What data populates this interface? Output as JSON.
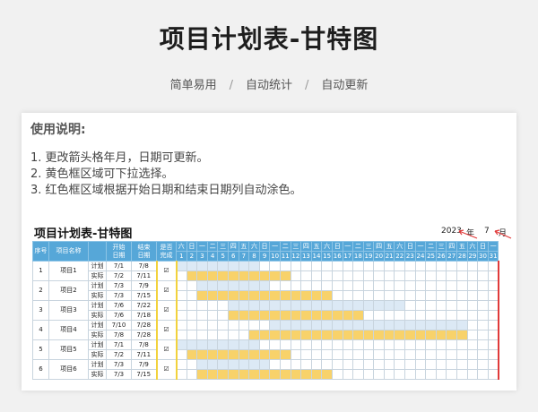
{
  "header": {
    "title": "项目计划表-甘特图",
    "subtitle_items": [
      "简单易用",
      "自动统计",
      "自动更新"
    ],
    "separator": "/"
  },
  "usage": {
    "title": "使用说明:",
    "items": [
      "1. 更改箭头格年月，日期可更新。",
      "2. 黄色框区域可下拉选择。",
      "3. 红色框区域根据开始日期和结束日期列自动涂色。"
    ]
  },
  "sheet": {
    "title": "项目计划表-甘特图",
    "year": "2023",
    "year_label": "年",
    "month": "7",
    "month_label": "月",
    "columns": {
      "seq": "序号",
      "name": "项目名称",
      "type": "",
      "start": "开始\n日期",
      "end": "结束\n日期",
      "done": "是否\n完成"
    },
    "weekdays": [
      "六",
      "日",
      "一",
      "二",
      "三",
      "四",
      "五",
      "六",
      "日",
      "一",
      "二",
      "三",
      "四",
      "五",
      "六",
      "日",
      "一",
      "二",
      "三",
      "四",
      "五",
      "六",
      "日",
      "一",
      "二",
      "三",
      "四",
      "五",
      "六",
      "日",
      "一"
    ],
    "days": [
      1,
      2,
      3,
      4,
      5,
      6,
      7,
      8,
      9,
      10,
      11,
      12,
      13,
      14,
      15,
      16,
      17,
      18,
      19,
      20,
      21,
      22,
      23,
      24,
      25,
      26,
      27,
      28,
      29,
      30,
      31
    ],
    "projects": [
      {
        "seq": "1",
        "name": "项目1",
        "rows": [
          {
            "type": "计划",
            "start": "7/1",
            "end": "7/8",
            "from": 1,
            "to": 8
          },
          {
            "type": "实际",
            "start": "7/2",
            "end": "7/11",
            "from": 2,
            "to": 11
          }
        ],
        "done": "☑"
      },
      {
        "seq": "2",
        "name": "项目2",
        "rows": [
          {
            "type": "计划",
            "start": "7/3",
            "end": "7/9",
            "from": 3,
            "to": 9
          },
          {
            "type": "实际",
            "start": "7/3",
            "end": "7/15",
            "from": 3,
            "to": 15
          }
        ],
        "done": "☑"
      },
      {
        "seq": "3",
        "name": "项目3",
        "rows": [
          {
            "type": "计划",
            "start": "7/6",
            "end": "7/22",
            "from": 6,
            "to": 22
          },
          {
            "type": "实际",
            "start": "7/6",
            "end": "7/18",
            "from": 6,
            "to": 18
          }
        ],
        "done": "☑"
      },
      {
        "seq": "4",
        "name": "项目4",
        "rows": [
          {
            "type": "计划",
            "start": "7/10",
            "end": "7/28",
            "from": 10,
            "to": 28
          },
          {
            "type": "实际",
            "start": "7/8",
            "end": "7/28",
            "from": 8,
            "to": 28
          }
        ],
        "done": "☑"
      },
      {
        "seq": "5",
        "name": "项目5",
        "rows": [
          {
            "type": "计划",
            "start": "7/1",
            "end": "7/8",
            "from": 1,
            "to": 8
          },
          {
            "type": "实际",
            "start": "7/2",
            "end": "7/11",
            "from": 2,
            "to": 11
          }
        ],
        "done": "☑"
      },
      {
        "seq": "6",
        "name": "项目6",
        "rows": [
          {
            "type": "计划",
            "start": "7/3",
            "end": "7/9",
            "from": 3,
            "to": 9
          },
          {
            "type": "实际",
            "start": "7/3",
            "end": "7/15",
            "from": 3,
            "to": 15
          }
        ],
        "done": "☑"
      }
    ]
  },
  "colors": {
    "header_blue": "#56a7d8",
    "plan_bar": "#dce9f5",
    "actual_bar": "#f8d26a",
    "select_box": "#f2d23c",
    "auto_box": "#e03a3a"
  }
}
